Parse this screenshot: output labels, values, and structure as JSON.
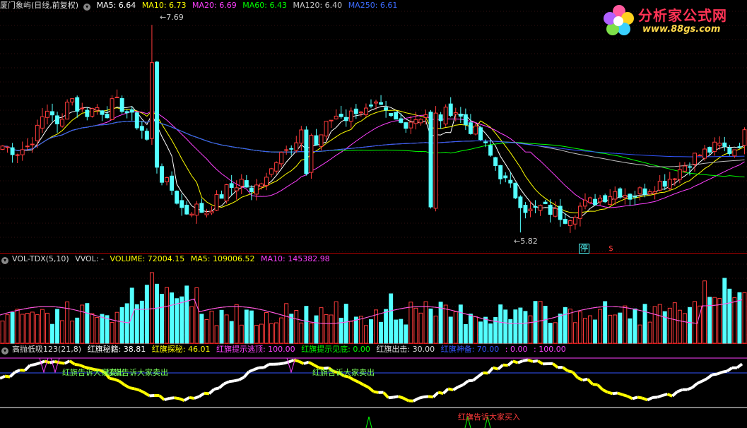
{
  "main_header": {
    "title": "厦门象屿(日线,前复权)",
    "ma5": "MA5: 6.64",
    "ma10": "MA10: 6.73",
    "ma20": "MA20: 6.69",
    "ma60": "MA60: 6.43",
    "ma120": "MA120: 6.40",
    "ma250": "MA250: 6.61"
  },
  "logo": {
    "title": "分析家公式网",
    "url": "www.88gs.com"
  },
  "price_labels": {
    "high": "7.69",
    "low": "5.82",
    "tag1": "停",
    "tag2": "$"
  },
  "vol_header": {
    "name": "VOL-TDX(5,10)",
    "vvol": "VVOL: -",
    "volume": "VOLUME: 72004.15",
    "ma5": "MA5: 109006.52",
    "ma10": "MA10: 145382.98"
  },
  "ind_header": {
    "name": "高抛低吸123(21,8)",
    "secret": "红旗秘籍: 38.81",
    "probe": "红旗探秘: 46.01",
    "escape": "红旗提示逃顶: 100.00",
    "bottom": "红旗提示见底: 0.00",
    "attack": "红旗出击: 30.00",
    "god": "红旗神备: 70.00",
    "v1": ": 0.00",
    "v2": ": 100.00"
  },
  "signals": {
    "sell1": "红旗告诉大家卖出",
    "sell2": "红旗告诉大家卖出",
    "sell3": "红旗告诉大家卖出",
    "buy": "红旗告诉大家买入"
  },
  "colors": {
    "up": "#ff3b3b",
    "down": "#54ffff",
    "ma5": "#ffffff",
    "ma10": "#ffff00",
    "ma20": "#ff40ff",
    "ma60": "#00ff00",
    "ma120": "#c0c0c0",
    "ma250": "#3355ff"
  },
  "chart_data": [
    {
      "type": "candlestick",
      "title": "厦门象屿(日线,前复权)",
      "x_count": 150,
      "price_range": [
        5.7,
        7.8
      ],
      "extremes": {
        "high": 7.69,
        "low": 5.82
      },
      "anchors": [
        [
          0,
          6.6
        ],
        [
          12,
          6.55
        ],
        [
          20,
          6.6
        ],
        [
          28,
          6.75
        ],
        [
          33,
          6.9
        ],
        [
          38,
          6.95
        ],
        [
          45,
          6.7
        ],
        [
          52,
          7.1
        ],
        [
          58,
          6.95
        ],
        [
          66,
          6.9
        ],
        [
          74,
          6.95
        ],
        [
          82,
          6.9
        ],
        [
          88,
          7.0
        ],
        [
          95,
          6.95
        ],
        [
          102,
          6.85
        ],
        [
          110,
          6.75
        ],
        [
          118,
          6.55
        ],
        [
          126,
          6.3
        ],
        [
          134,
          6.2
        ],
        [
          140,
          6.05
        ],
        [
          146,
          6.0
        ],
        [
          152,
          6.05
        ],
        [
          160,
          6.0
        ],
        [
          168,
          6.1
        ],
        [
          176,
          6.2
        ],
        [
          184,
          6.25
        ],
        [
          190,
          6.3
        ],
        [
          196,
          6.15
        ],
        [
          204,
          6.3
        ],
        [
          212,
          6.4
        ],
        [
          220,
          6.6
        ],
        [
          228,
          6.55
        ],
        [
          234,
          6.65
        ],
        [
          240,
          6.8
        ],
        [
          247,
          6.6
        ],
        [
          253,
          6.75
        ],
        [
          260,
          6.85
        ],
        [
          266,
          6.9
        ],
        [
          272,
          6.85
        ],
        [
          280,
          6.95
        ],
        [
          288,
          6.9
        ],
        [
          296,
          6.95
        ],
        [
          305,
          6.85
        ],
        [
          315,
          6.8
        ],
        [
          325,
          6.85
        ],
        [
          335,
          6.9
        ],
        [
          345,
          6.85
        ],
        [
          355,
          6.95
        ],
        [
          365,
          6.8
        ],
        [
          375,
          6.7
        ],
        [
          385,
          6.5
        ],
        [
          395,
          6.3
        ],
        [
          405,
          6.15
        ],
        [
          415,
          6.0
        ],
        [
          425,
          6.05
        ],
        [
          435,
          6.0
        ],
        [
          445,
          5.95
        ],
        [
          455,
          6.05
        ],
        [
          465,
          6.1
        ],
        [
          475,
          6.15
        ],
        [
          485,
          6.2
        ],
        [
          495,
          6.15
        ],
        [
          505,
          6.2
        ],
        [
          515,
          6.25
        ],
        [
          525,
          6.3
        ],
        [
          535,
          6.4
        ],
        [
          545,
          6.5
        ],
        [
          555,
          6.55
        ],
        [
          565,
          6.6
        ],
        [
          575,
          6.55
        ],
        [
          585,
          6.7
        ]
      ],
      "series_ma": [
        "MA5",
        "MA10",
        "MA20",
        "MA60",
        "MA120",
        "MA250"
      ],
      "ma_values": {
        "MA5": 6.64,
        "MA10": 6.73,
        "MA20": 6.69,
        "MA60": 6.43,
        "MA120": 6.4,
        "MA250": 6.61
      }
    },
    {
      "type": "bar",
      "title": "VOL-TDX(5,10)",
      "volume": 72004.15,
      "ma5": 109006.52,
      "ma10": 145382.98
    },
    {
      "type": "line",
      "title": "高抛低吸123(21,8)",
      "ylim": [
        0,
        100
      ],
      "levels": {
        "escape": 100.0,
        "bottom": 0.0,
        "attack": 30.0,
        "god": 70.0
      },
      "values": {
        "secret": 38.81,
        "probe": 46.01
      }
    }
  ]
}
